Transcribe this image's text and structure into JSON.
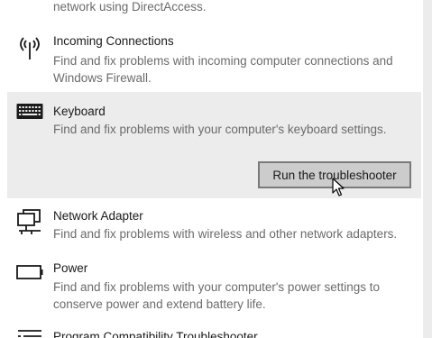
{
  "items": [
    {
      "desc_line": "network using DirectAccess."
    },
    {
      "title": "Incoming Connections",
      "desc": "Find and fix problems with incoming computer connections and Windows Firewall.",
      "icon": "antenna-icon"
    },
    {
      "title": "Keyboard",
      "desc": "Find and fix problems with your computer's keyboard settings.",
      "icon": "keyboard-icon",
      "button": "Run the troubleshooter"
    },
    {
      "title": "Network Adapter",
      "desc": "Find and fix problems with wireless and other network adapters.",
      "icon": "network-adapter-icon"
    },
    {
      "title": "Power",
      "desc": "Find and fix problems with your computer's power settings to conserve power and extend battery life.",
      "icon": "battery-icon"
    },
    {
      "title": "Program Compatibility Troubleshooter",
      "icon": "program-compatibility-icon"
    }
  ],
  "colors": {
    "selected_bg": "#ececec",
    "button_bg": "#cccccc",
    "button_border": "#7a7a7a",
    "description_text": "#6b6b6b"
  }
}
